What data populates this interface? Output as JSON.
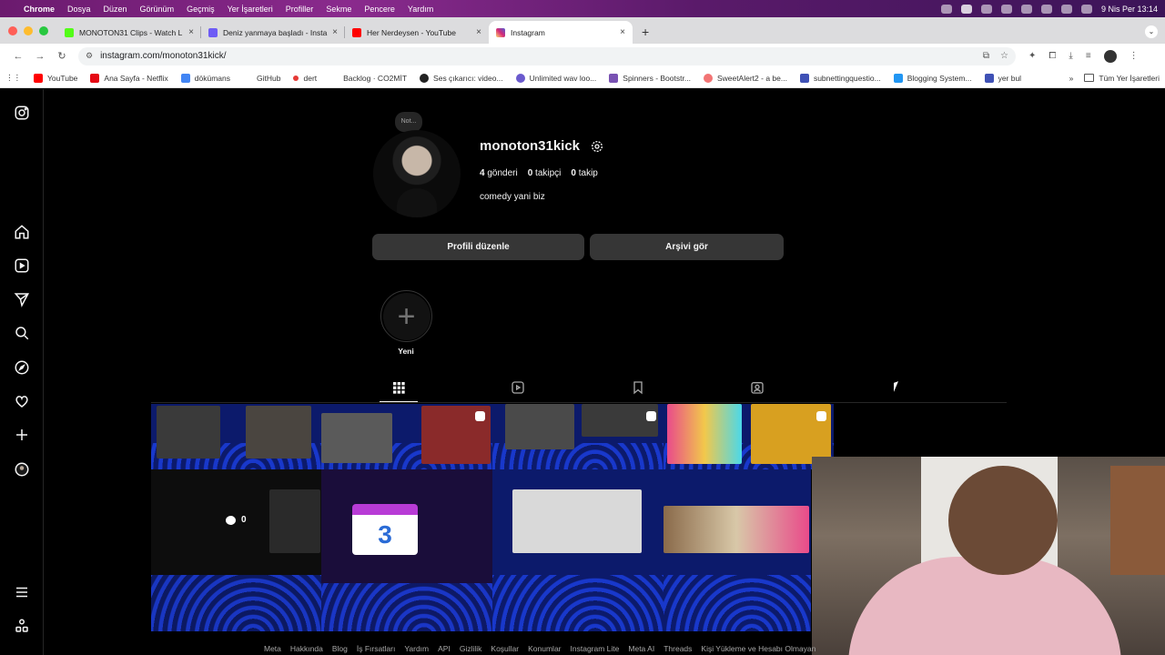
{
  "menubar": {
    "app": "Chrome",
    "items": [
      "Dosya",
      "Düzen",
      "Görünüm",
      "Geçmiş",
      "Yer İşaretleri",
      "Profiller",
      "Sekme",
      "Pencere",
      "Yardım"
    ],
    "clock": "9 Nis Per  13:14"
  },
  "tabs": [
    {
      "title": "MONOTON31 Clips - Watch L",
      "color": "#53fc18"
    },
    {
      "title": "Deniz yanmaya başladı - Insta",
      "color": "#6e5cf5"
    },
    {
      "title": "Her Nerdeysen - YouTube",
      "color": "#ff0000"
    },
    {
      "title": "Instagram",
      "color": "#e1306c"
    }
  ],
  "address": {
    "url": "instagram.com/monoton31kick/"
  },
  "bookmarks": [
    {
      "label": "YouTube",
      "color": "#ff0000"
    },
    {
      "label": "Ana Sayfa - Netflix",
      "color": "#e50914"
    },
    {
      "label": "dökümans",
      "color": "#4285f4"
    },
    {
      "label": "GitHub",
      "color": "#ffffff"
    },
    {
      "label": "dert",
      "color": "#e53935"
    },
    {
      "label": "Backlog · CO2MİT",
      "color": "#ffffff"
    },
    {
      "label": "Ses çıkarıcı: video...",
      "color": "#222222"
    },
    {
      "label": "Unlimited wav loo...",
      "color": "#6a5acd"
    },
    {
      "label": "Spinners - Bootstr...",
      "color": "#7952b3"
    },
    {
      "label": "SweetAlert2 - a be...",
      "color": "#f27474"
    },
    {
      "label": "subnettingquestio...",
      "color": "#3f51b5"
    },
    {
      "label": "Blogging System...",
      "color": "#2196f3"
    },
    {
      "label": "yer bul",
      "color": "#3f51b5"
    }
  ],
  "bookmarks_folder": "Tüm Yer İşaretleri",
  "profile": {
    "note": "Not...",
    "username": "monoton31kick",
    "posts": "4",
    "posts_label": "gönderi",
    "followers": "0",
    "followers_label": "takipçi",
    "following": "0",
    "following_label": "takip",
    "bio": "comedy yani biz",
    "edit_button": "Profili düzenle",
    "archive_button": "Arşivi gör",
    "highlight_new": "Yeni"
  },
  "grid": {
    "comment_count": "0",
    "calendar_day": "3"
  },
  "footer": [
    "Meta",
    "Hakkında",
    "Blog",
    "İş Fırsatları",
    "Yardım",
    "API",
    "Gizlilik",
    "Koşullar",
    "Konumlar",
    "Instagram Lite",
    "Meta AI",
    "Threads",
    "Kişi Yükleme ve Hesabı Olmayan"
  ]
}
